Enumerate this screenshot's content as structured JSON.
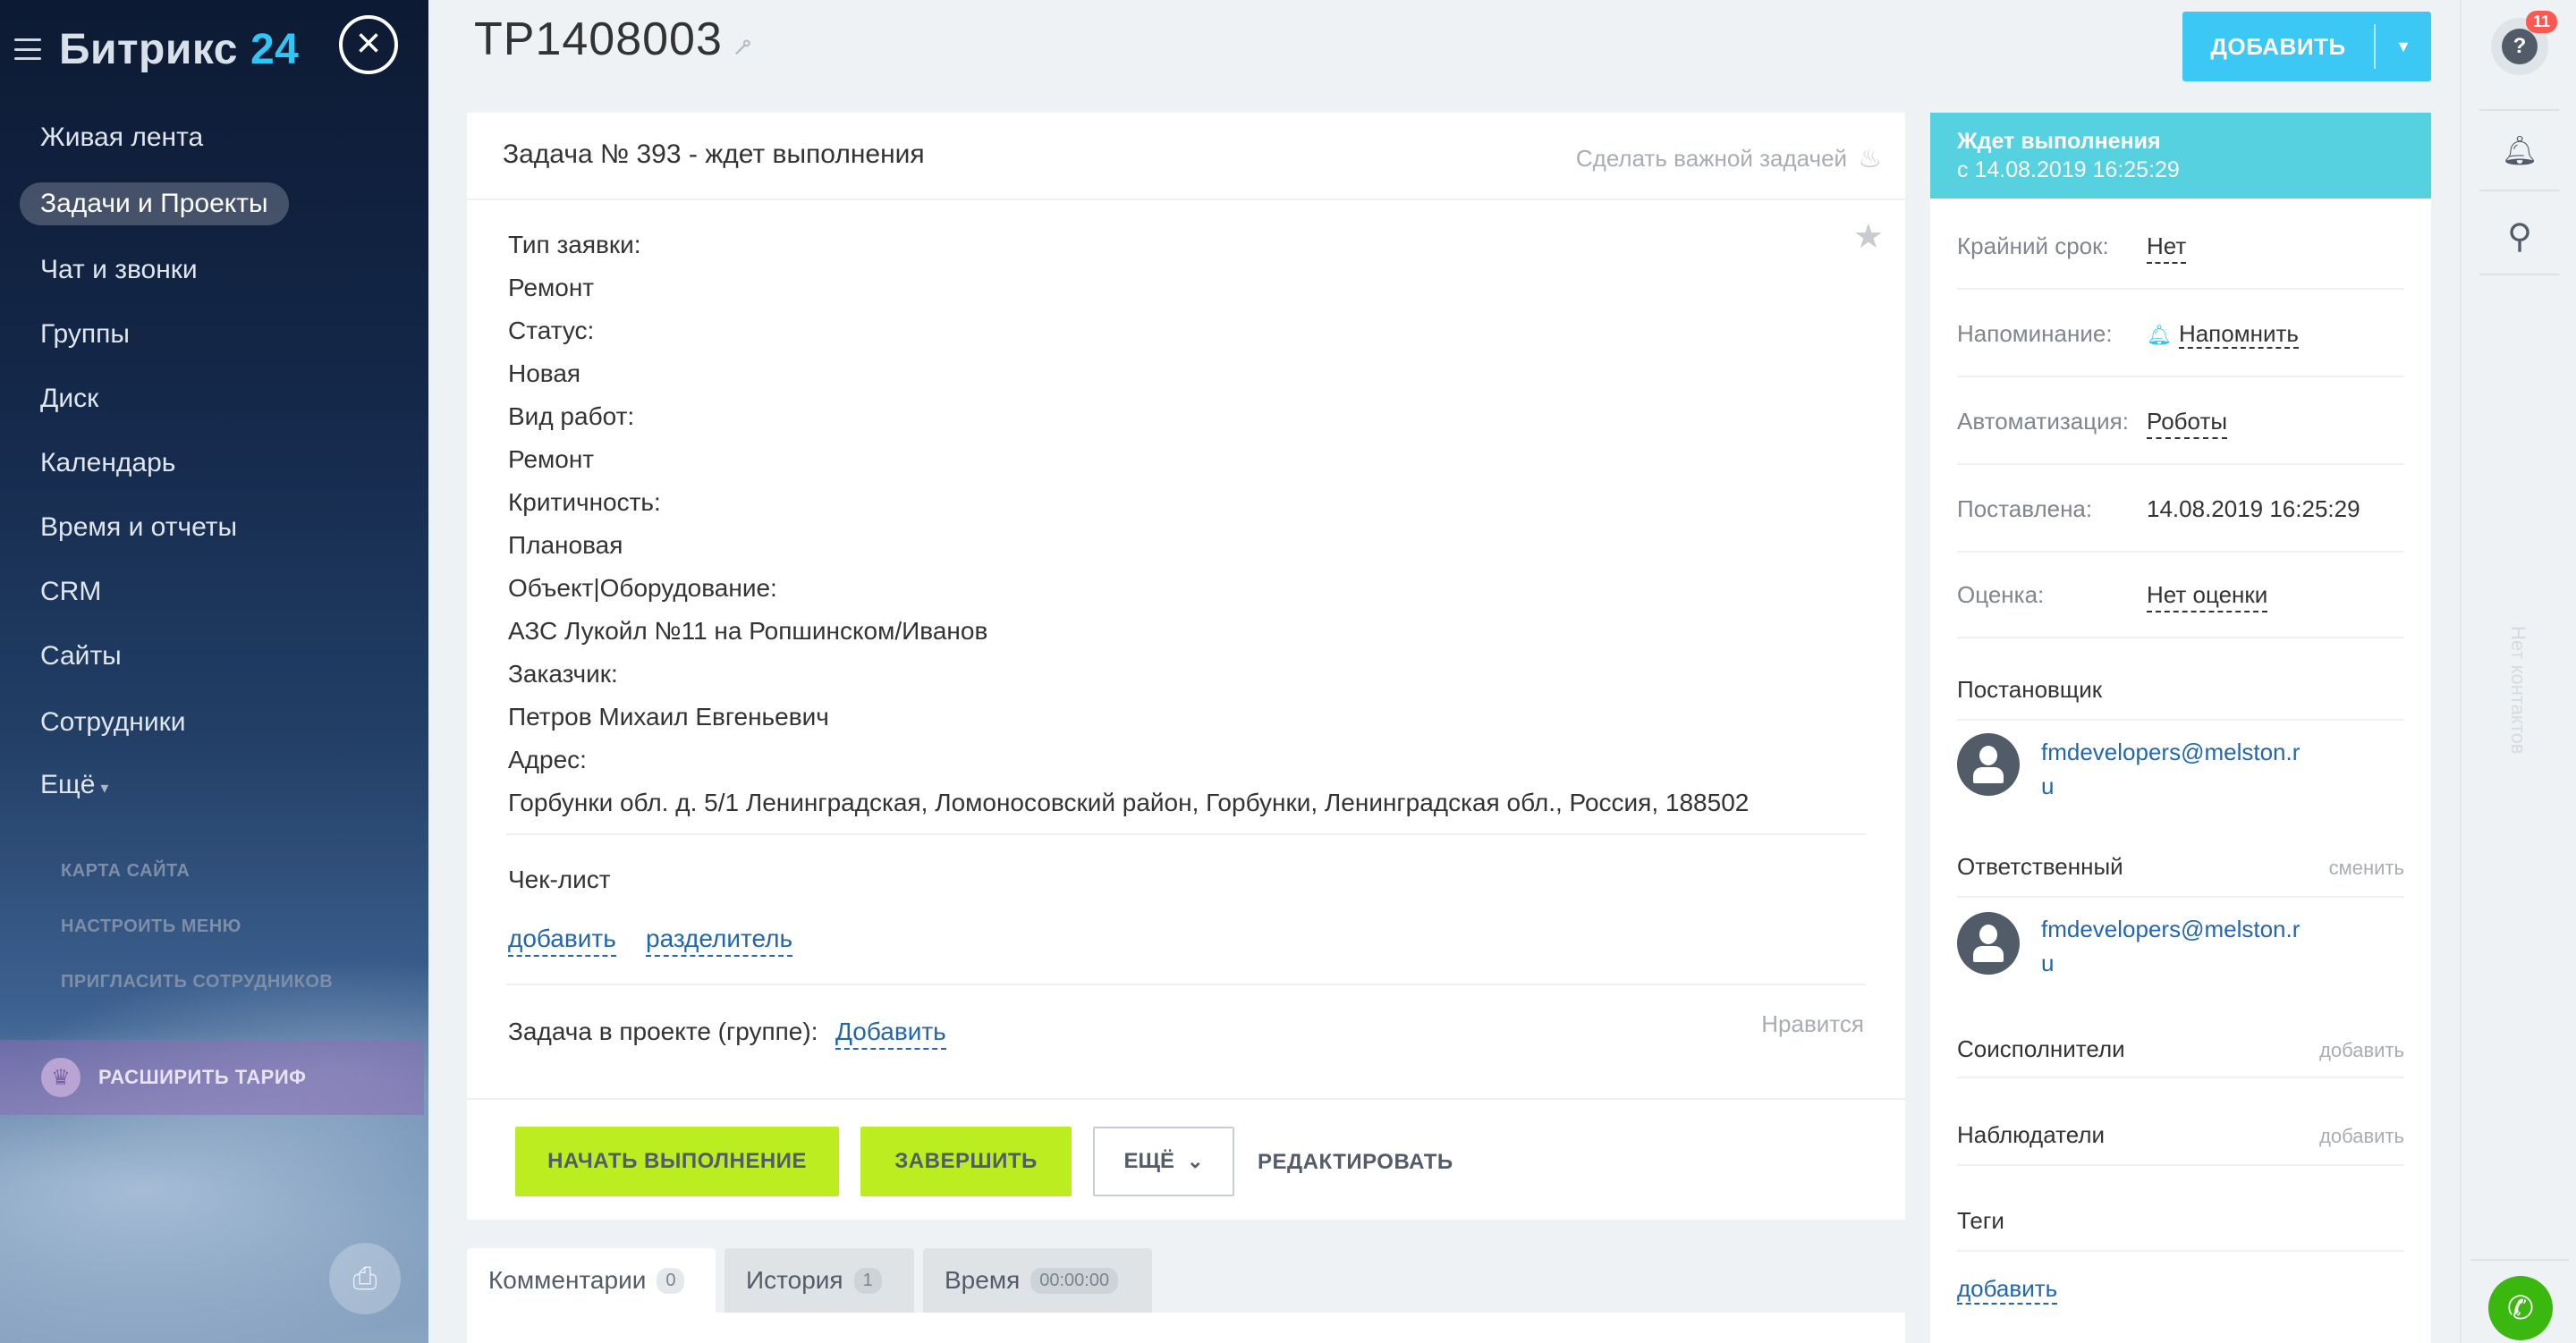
{
  "sidebar": {
    "logo_text": "Битрикс",
    "logo_number": "24",
    "menu": [
      {
        "label": "Живая лента"
      },
      {
        "label": "Задачи и Проекты",
        "active": true
      },
      {
        "label": "Чат и звонки"
      },
      {
        "label": "Группы"
      },
      {
        "label": "Диск"
      },
      {
        "label": "Календарь"
      },
      {
        "label": "Время и отчеты"
      },
      {
        "label": "CRM"
      },
      {
        "label": "Сайты"
      },
      {
        "label": "Сотрудники"
      },
      {
        "label": "Ещё"
      }
    ],
    "small_links": [
      "КАРТА САЙТА",
      "НАСТРОИТЬ МЕНЮ",
      "ПРИГЛАСИТЬ СОТРУДНИКОВ"
    ],
    "tariff_label": "РАСШИРИТЬ ТАРИФ"
  },
  "header": {
    "title": "TP1408003",
    "add_button": "ДОБАВИТЬ"
  },
  "task": {
    "title": "Задача № 393 - ждет выполнения",
    "make_important": "Сделать важной задачей",
    "description": [
      "Тип заявки:",
      "Ремонт",
      "Статус:",
      "Новая",
      "Вид работ:",
      "Ремонт",
      "Критичность:",
      "Плановая",
      "Объект|Оборудование:",
      "АЗС Лукойл №11 на Ропшинском/Иванов",
      "Заказчик:",
      "Петров Михаил Евгеньевич",
      "Адрес:",
      "Горбунки обл. д. 5/1 Ленинградская, Ломоносовский район, Горбунки, Ленинградская обл., Россия, 188502"
    ],
    "checklist_title": "Чек-лист",
    "checklist_add": "добавить",
    "checklist_separator": "разделитель",
    "project_label": "Задача в проекте (группе):",
    "project_add": "Добавить",
    "like": "Нравится",
    "buttons": {
      "start": "НАЧАТЬ ВЫПОЛНЕНИЕ",
      "finish": "ЗАВЕРШИТЬ",
      "more": "ЕЩЁ",
      "edit": "РЕДАКТИРОВАТЬ"
    }
  },
  "tabs": [
    {
      "label": "Комментарии",
      "count": "0"
    },
    {
      "label": "История",
      "count": "1"
    },
    {
      "label": "Время",
      "count": "00:00:00"
    }
  ],
  "info": {
    "status_title": "Ждет выполнения",
    "status_date": "с 14.08.2019 16:25:29",
    "deadline_label": "Крайний срок:",
    "deadline_value": "Нет",
    "reminder_label": "Напоминание:",
    "reminder_value": "Напомнить",
    "automation_label": "Автоматизация:",
    "automation_value": "Роботы",
    "created_label": "Поставлена:",
    "created_value": "14.08.2019 16:25:29",
    "rating_label": "Оценка:",
    "rating_value": "Нет оценки",
    "creator_title": "Постановщик",
    "creator_email": "fmdevelopers@melston.ru",
    "responsible_title": "Ответственный",
    "responsible_change": "сменить",
    "responsible_email": "fmdevelopers@melston.ru",
    "coexecutors_title": "Соисполнители",
    "coexecutors_add": "добавить",
    "observers_title": "Наблюдатели",
    "observers_add": "добавить",
    "tags_title": "Теги",
    "tags_add": "добавить"
  },
  "rightbar": {
    "help_badge": "11",
    "vertical_text": "Нет контактов"
  },
  "colors": {
    "accent_blue": "#3bc8f5",
    "status_teal": "#56d1e0",
    "action_green": "#bbed21",
    "link_blue": "#2067b0"
  }
}
